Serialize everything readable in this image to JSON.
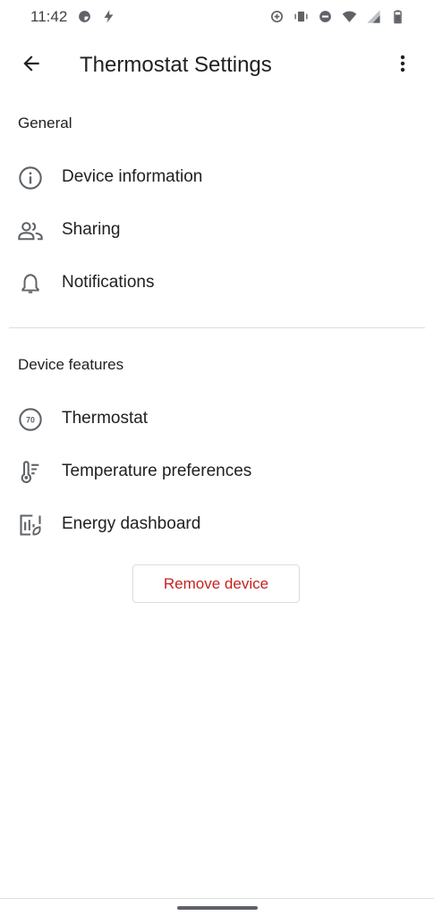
{
  "status_bar": {
    "time": "11:42",
    "left_icons": [
      "data-saver-icon",
      "flash-icon"
    ],
    "right_icons": [
      "add-alarm-icon",
      "vibrate-icon",
      "do-not-disturb-icon",
      "wifi-icon",
      "signal-icon",
      "battery-icon"
    ]
  },
  "app_bar": {
    "title": "Thermostat Settings",
    "back_icon": "arrow-back-icon",
    "more_icon": "more-vert-icon"
  },
  "sections": {
    "general": {
      "header": "General",
      "items": [
        {
          "label": "Device information",
          "icon": "info-icon"
        },
        {
          "label": "Sharing",
          "icon": "people-icon"
        },
        {
          "label": "Notifications",
          "icon": "bell-icon"
        }
      ]
    },
    "device_features": {
      "header": "Device features",
      "items": [
        {
          "label": "Thermostat",
          "icon": "thermostat-dial-icon",
          "icon_text": "70"
        },
        {
          "label": "Temperature preferences",
          "icon": "thermometer-icon"
        },
        {
          "label": "Energy dashboard",
          "icon": "energy-dashboard-icon"
        }
      ]
    }
  },
  "remove_button": {
    "label": "Remove device"
  },
  "colors": {
    "text": "#202124",
    "danger": "#c5221f",
    "divider": "#dadce0",
    "icon": "#5f6368"
  }
}
